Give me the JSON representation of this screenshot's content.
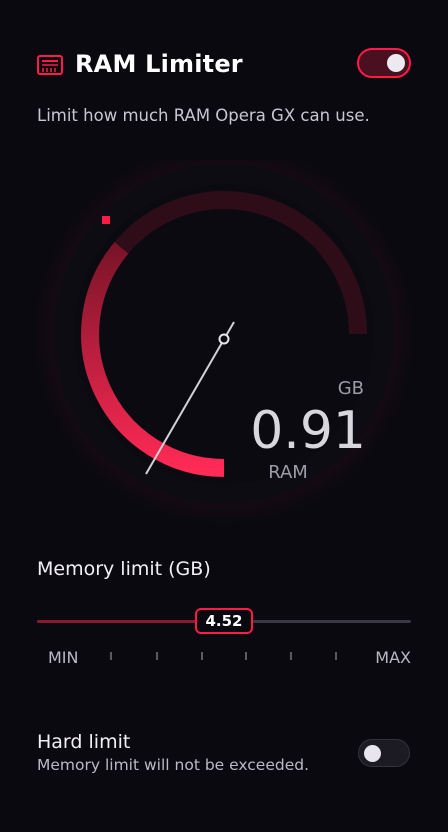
{
  "header": {
    "title": "RAM Limiter",
    "icon": "ram-chip-icon",
    "enabled": true
  },
  "subtitle": "Limit how much RAM Opera GX can use.",
  "gauge": {
    "value": "0.91",
    "unit": "GB",
    "label": "RAM",
    "limit_fraction": 0.6
  },
  "memory_limit": {
    "label": "Memory limit (GB)",
    "value": "4.52",
    "fraction": 0.5,
    "min_label": "MIN",
    "max_label": "MAX"
  },
  "hard_limit": {
    "label": "Hard limit",
    "description": "Memory limit will not be exceeded.",
    "enabled": false
  },
  "colors": {
    "accent": "#ff1a47",
    "background": "#0b0910"
  }
}
